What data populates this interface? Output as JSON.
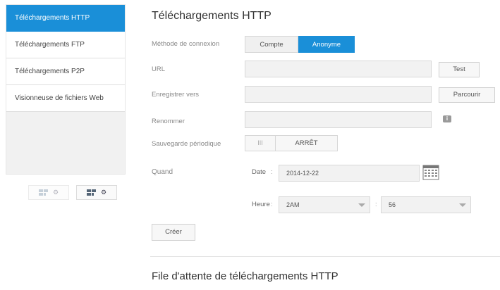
{
  "sidebar": {
    "items": [
      {
        "label": "Téléchargements HTTP",
        "active": true
      },
      {
        "label": "Téléchargements FTP",
        "active": false
      },
      {
        "label": "Téléchargements P2P",
        "active": false
      },
      {
        "label": "Visionneuse de fichiers Web",
        "active": false
      }
    ],
    "view_toggle": [
      {
        "icon": "list-view-icon",
        "active": false
      },
      {
        "icon": "grid-view-icon",
        "active": true
      }
    ]
  },
  "main": {
    "title": "Téléchargements HTTP",
    "connection": {
      "label": "Méthode de connexion",
      "options": [
        "Compte",
        "Anonyme"
      ],
      "selected": "Anonyme"
    },
    "url": {
      "label": "URL",
      "value": "",
      "button": "Test"
    },
    "save_to": {
      "label": "Enregistrer vers",
      "value": "",
      "button": "Parcourir"
    },
    "rename": {
      "label": "Renommer",
      "value": "",
      "icon": "info-icon"
    },
    "periodic_backup": {
      "label": "Sauvegarde périodique",
      "grip": "III",
      "state": "ARRÊT"
    },
    "when": {
      "label": "Quand",
      "date_label": "Date",
      "date_value": "2014-12-22",
      "date_icon": "calendar-icon",
      "time_label": "Heure",
      "hour_value": "2AM",
      "minute_value": "56",
      "separator": ":"
    },
    "create_button": "Créer",
    "queue_title": "File d'attente de téléchargements HTTP"
  },
  "colors": {
    "accent": "#1a8fd8",
    "field_bg": "#f2f2f2",
    "text": "#555555"
  }
}
